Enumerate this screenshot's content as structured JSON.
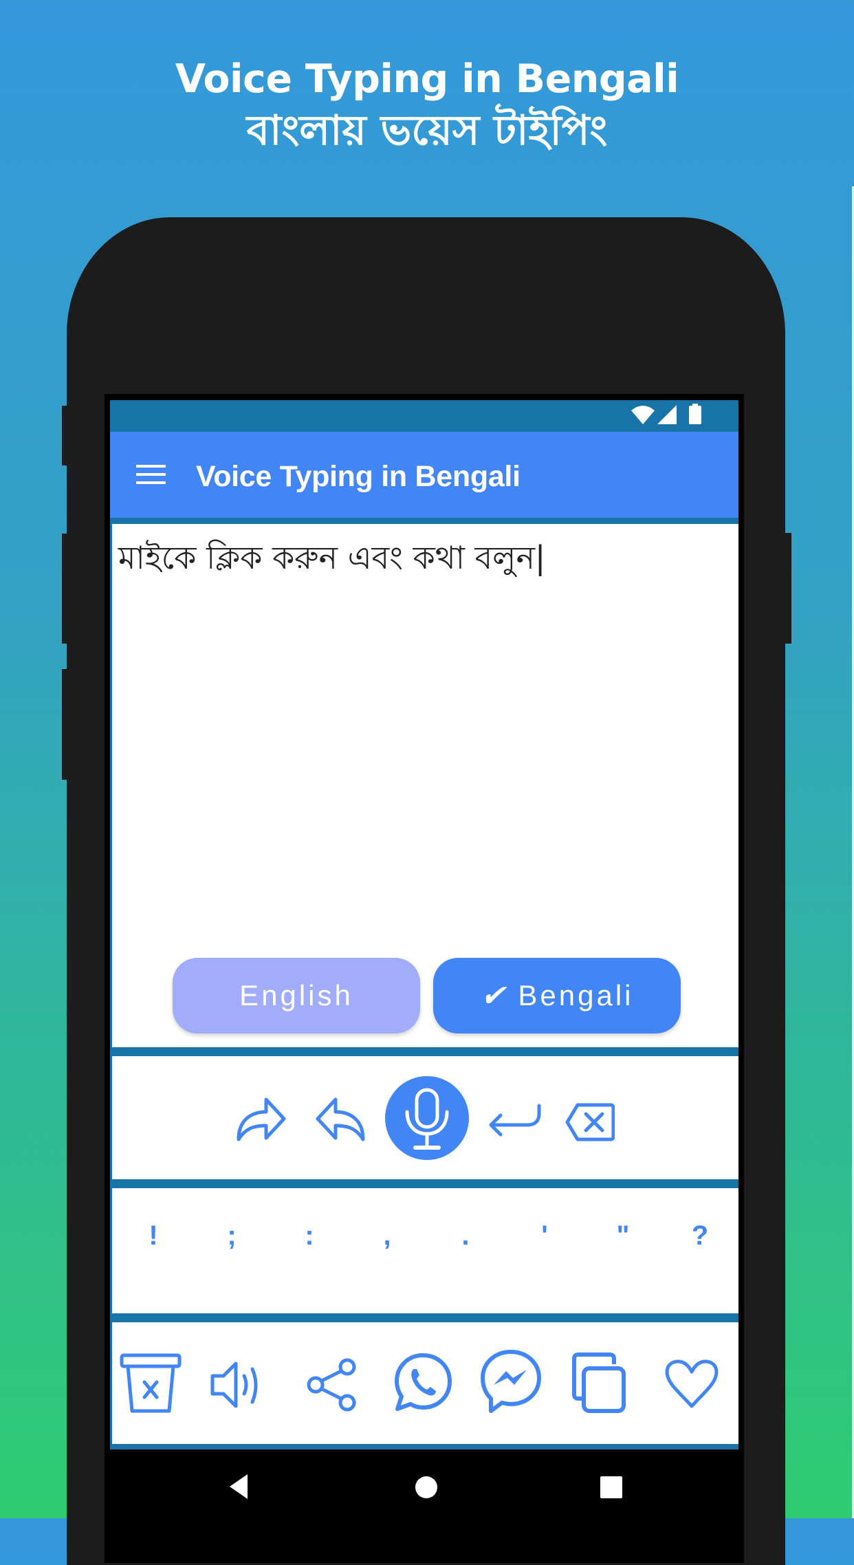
{
  "promo": {
    "title_en": "Voice Typing in Bengali",
    "title_bn": "বাংলায় ভয়েস টাইপিং"
  },
  "status_bar": {
    "icons": [
      "wifi-icon",
      "cellular-signal-icon",
      "battery-icon"
    ]
  },
  "app_bar": {
    "menu_icon": "hamburger-menu-icon",
    "title": "Voice Typing in Bengali"
  },
  "editor": {
    "text": "মাইকে ক্লিক করুন এবং কথা বলুন|"
  },
  "language_toggle": {
    "english_label": "English",
    "bengali_label": "Bengali",
    "selected": "Bengali",
    "check_mark": "✔"
  },
  "toolbar": {
    "icons": [
      "redo-icon",
      "undo-icon",
      "microphone-icon",
      "enter-icon",
      "backspace-icon"
    ]
  },
  "punctuation": [
    "!",
    ";",
    ":",
    ",",
    ".",
    "'",
    "\"",
    "?"
  ],
  "actions": {
    "icons": [
      "clear-trash-icon",
      "speak-icon",
      "share-icon",
      "whatsapp-icon",
      "messenger-icon",
      "copy-icon",
      "favorite-heart-icon"
    ]
  },
  "nav_bar": {
    "icons": [
      "back-icon",
      "home-icon",
      "recents-icon"
    ]
  },
  "colors": {
    "accent": "#4285f4",
    "accent_light": "#a1adfa",
    "status_bar": "#1874a8",
    "bg_top": "#3498db",
    "bg_bottom": "#2ecc71",
    "bezel": "#1c1c1c"
  }
}
